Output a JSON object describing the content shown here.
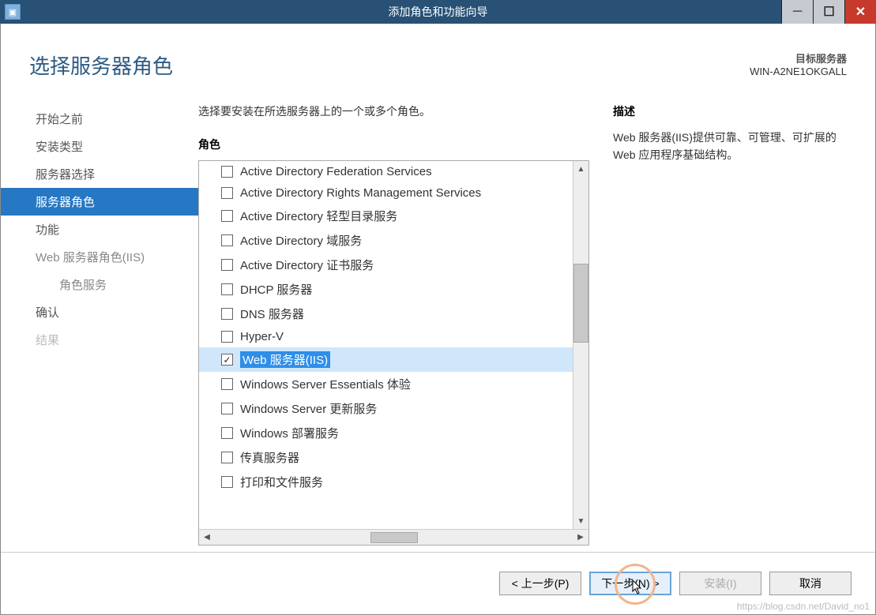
{
  "titlebar": {
    "title": "添加角色和功能向导"
  },
  "header": {
    "page_title": "选择服务器角色",
    "target_label": "目标服务器",
    "target_name": "WIN-A2NE1OKGALL"
  },
  "sidebar": {
    "items": [
      {
        "label": "开始之前",
        "state": "normal"
      },
      {
        "label": "安装类型",
        "state": "normal"
      },
      {
        "label": "服务器选择",
        "state": "normal"
      },
      {
        "label": "服务器角色",
        "state": "active"
      },
      {
        "label": "功能",
        "state": "normal"
      },
      {
        "label": "Web 服务器角色(IIS)",
        "state": "light"
      },
      {
        "label": "角色服务",
        "state": "light",
        "sub": true
      },
      {
        "label": "确认",
        "state": "normal"
      },
      {
        "label": "结果",
        "state": "disabled"
      }
    ]
  },
  "main": {
    "instruction": "选择要安装在所选服务器上的一个或多个角色。",
    "roles_label": "角色",
    "roles": [
      {
        "label": "Active Directory Federation Services",
        "checked": false,
        "selected": false
      },
      {
        "label": "Active Directory Rights Management Services",
        "checked": false,
        "selected": false
      },
      {
        "label": "Active Directory 轻型目录服务",
        "checked": false,
        "selected": false
      },
      {
        "label": "Active Directory 域服务",
        "checked": false,
        "selected": false
      },
      {
        "label": "Active Directory 证书服务",
        "checked": false,
        "selected": false
      },
      {
        "label": "DHCP 服务器",
        "checked": false,
        "selected": false
      },
      {
        "label": "DNS 服务器",
        "checked": false,
        "selected": false
      },
      {
        "label": "Hyper-V",
        "checked": false,
        "selected": false
      },
      {
        "label": "Web 服务器(IIS)",
        "checked": true,
        "selected": true
      },
      {
        "label": "Windows Server Essentials 体验",
        "checked": false,
        "selected": false
      },
      {
        "label": "Windows Server 更新服务",
        "checked": false,
        "selected": false
      },
      {
        "label": "Windows 部署服务",
        "checked": false,
        "selected": false
      },
      {
        "label": "传真服务器",
        "checked": false,
        "selected": false
      },
      {
        "label": "打印和文件服务",
        "checked": false,
        "selected": false
      }
    ],
    "desc_label": "描述",
    "desc_text": "Web 服务器(IIS)提供可靠、可管理、可扩展的 Web 应用程序基础结构。"
  },
  "footer": {
    "prev": "< 上一步(P)",
    "next": "下一步(N) >",
    "install": "安装(I)",
    "cancel": "取消"
  },
  "watermark": "https://blog.csdn.net/David_no1"
}
